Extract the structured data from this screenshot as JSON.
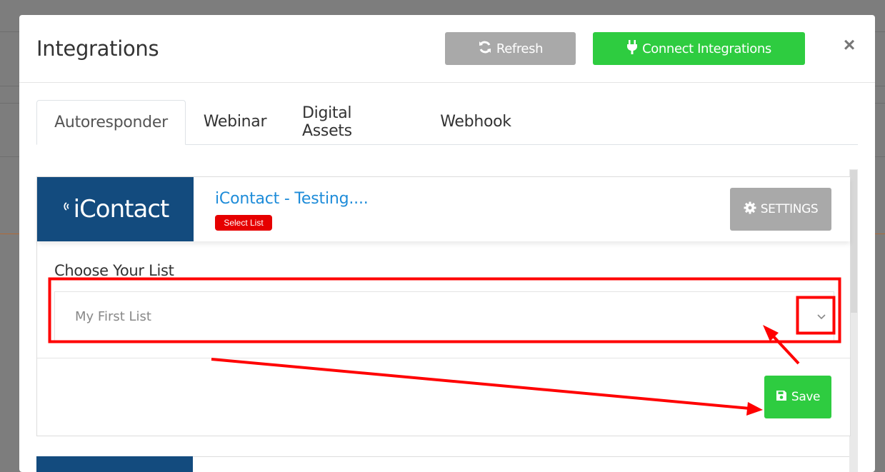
{
  "modal": {
    "title": "Integrations",
    "refresh_label": "Refresh",
    "connect_label": "Connect Integrations",
    "close_symbol": "×"
  },
  "tabs": [
    {
      "label": "Autoresponder",
      "active": true
    },
    {
      "label": "Webinar",
      "active": false
    },
    {
      "label": "Digital Assets",
      "active": false
    },
    {
      "label": "Webhook",
      "active": false
    }
  ],
  "integration": {
    "logo_text": "iContact",
    "name": "iContact - Testing....",
    "badge": "Select List",
    "settings_label": "SETTINGS",
    "choose_label": "Choose Your List",
    "selected_list": "My First List",
    "save_label": "Save"
  },
  "colors": {
    "green": "#2ecc40",
    "gray_button": "#a9a9a9",
    "brand_blue": "#134b7e",
    "link_blue": "#1e8cd9",
    "badge_red": "#e60000",
    "annotation_red": "#ff0000"
  },
  "icons": [
    "refresh-icon",
    "plug-icon",
    "close-icon",
    "gear-icon",
    "chevron-down-icon",
    "save-icon"
  ]
}
